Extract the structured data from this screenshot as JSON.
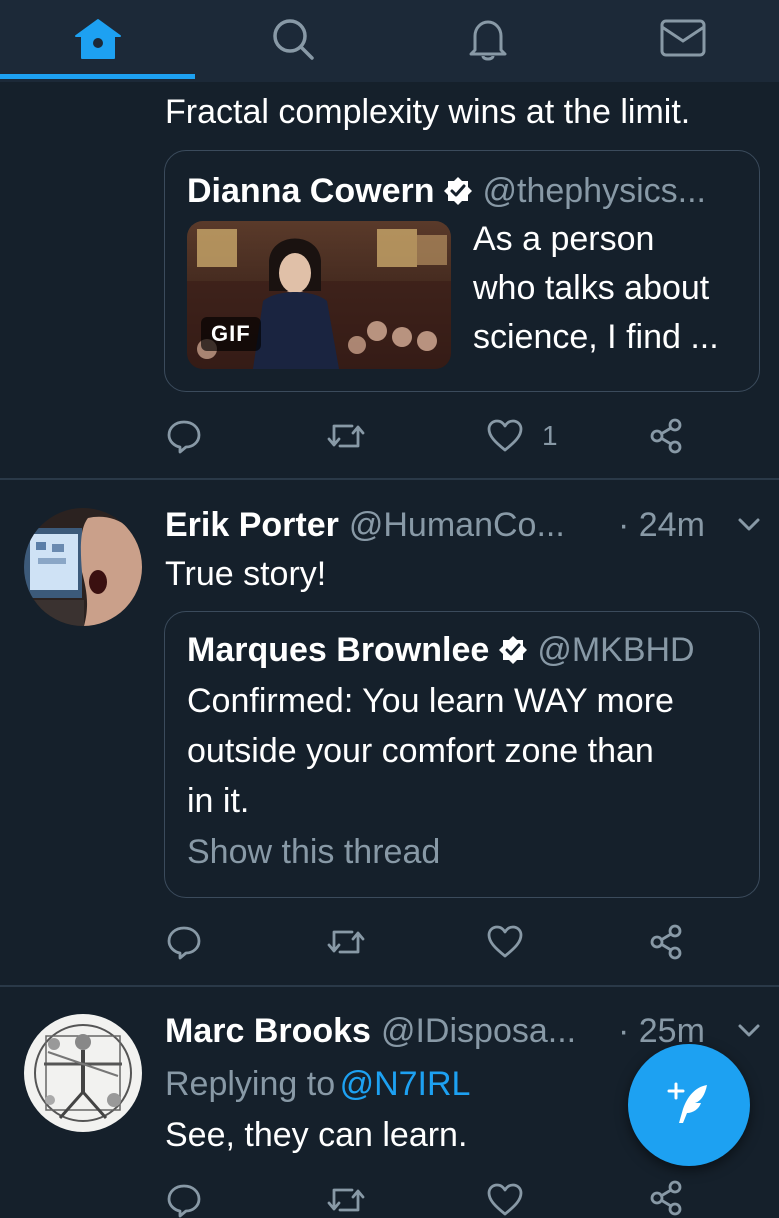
{
  "colors": {
    "background": "#15202b",
    "nav": "#1c2938",
    "accent": "#1da1f2",
    "muted": "#8899a6",
    "border": "#3b4b5c"
  },
  "nav": {
    "tabs": [
      {
        "name": "home",
        "icon": "home-icon",
        "active": true
      },
      {
        "name": "search",
        "icon": "search-icon",
        "active": false
      },
      {
        "name": "notifications",
        "icon": "bell-icon",
        "active": false
      },
      {
        "name": "messages",
        "icon": "mail-icon",
        "active": false
      }
    ]
  },
  "tweet1": {
    "text": "Fractal complexity wins at the limit.",
    "quote": {
      "name": "Dianna Cowern",
      "handle": "@thephysics...",
      "verified": true,
      "gif_label": "GIF",
      "text_lines": [
        "As a person",
        "who talks about",
        "science, I find ..."
      ]
    },
    "likes": "1"
  },
  "tweet2": {
    "name": "Erik Porter",
    "handle": "@HumanCo...",
    "time": "· 24m",
    "text": "True story!",
    "quote": {
      "name": "Marques Brownlee",
      "handle": "@MKBHD",
      "verified": true,
      "text_lines": [
        "Confirmed: You learn WAY more",
        "outside your comfort zone than",
        "in it."
      ],
      "show_thread": "Show this thread"
    }
  },
  "tweet3": {
    "name": "Marc Brooks",
    "handle": "@IDisposa...",
    "time": "· 25m",
    "replying_prefix": "Replying to",
    "replying_to": "@N7IRL",
    "text": "See, they can learn."
  }
}
